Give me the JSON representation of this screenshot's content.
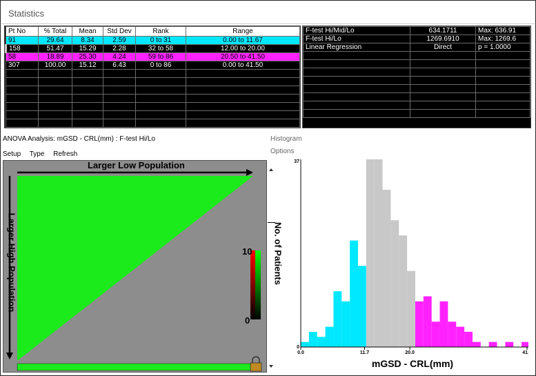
{
  "window": {
    "title": "Statistics"
  },
  "stats_table": {
    "headers": [
      "Pt No",
      "% Total",
      "Mean",
      "Std Dev",
      "Rank",
      "Range"
    ],
    "rows": [
      {
        "pt": "91",
        "pct": "29.64",
        "mean": "8.34",
        "sd": "2.59",
        "rank": "0 to 31",
        "range": "0.00 to 11.67",
        "color": "#00e8ff"
      },
      {
        "pt": "158",
        "pct": "51.47",
        "mean": "15.29",
        "sd": "2.28",
        "rank": "32 to 58",
        "range": "12.00 to 20.00",
        "color": "#c8c8c8"
      },
      {
        "pt": "58",
        "pct": "18.89",
        "mean": "25.30",
        "sd": "4.24",
        "rank": "59 to 86",
        "range": "20.50 to 41.50",
        "color": "#ff22ff"
      },
      {
        "pt": "307",
        "pct": "100.00",
        "mean": "15.12",
        "sd": "6.43",
        "rank": "0 to 86",
        "range": "0.00 to 41.50",
        "color": "#000000"
      }
    ]
  },
  "ftest_table": {
    "rows": [
      {
        "label": "F-test Hi/Mid/Lo",
        "value": "634.1711",
        "extra": "Max: 636.91"
      },
      {
        "label": "F-test Hi/Lo",
        "value": "1269.6910",
        "extra": "Max: 1269.6"
      },
      {
        "label": "Linear Regression",
        "value": "Direct",
        "extra": "p =  1.0000"
      }
    ]
  },
  "anova": {
    "title": "ANOVA Analysis: mGSD - CRL(mm) : F-test Hi/Lo",
    "menu": [
      "Setup",
      "Type",
      "Refresh"
    ],
    "x_arrow_label": "Larger Low Population",
    "y_arrow_label": "Larger High Population",
    "colorbar_max": "10",
    "colorbar_min": "0"
  },
  "histogram": {
    "title": "Histogram",
    "options": "Options",
    "ylabel": "No. of Patients",
    "xlabel": "mGSD - CRL(mm)",
    "ytick_top": "37",
    "ytick_bottom": "0"
  },
  "chart_data": {
    "type": "bar",
    "title": "Histogram",
    "xlabel": "mGSD - CRL(mm)",
    "ylabel": "No. of Patients",
    "xlim": [
      0,
      41.5
    ],
    "ylim": [
      0,
      37
    ],
    "xticks": [
      "0.0",
      "11.7",
      "20.0",
      "41.5"
    ],
    "bin_width": 1.5,
    "bins": [
      0.0,
      1.5,
      3.0,
      4.5,
      6.0,
      7.5,
      9.0,
      10.5,
      12.0,
      13.5,
      15.0,
      16.5,
      18.0,
      19.5,
      21.0,
      22.5,
      24.0,
      25.5,
      27.0,
      28.5,
      30.0,
      31.5,
      33.0,
      34.5,
      36.0,
      37.5,
      39.0,
      40.5
    ],
    "values": [
      1,
      3,
      2,
      4,
      11,
      9,
      21,
      16,
      37,
      37,
      31,
      25,
      22,
      15,
      9,
      10,
      5,
      9,
      5,
      4,
      3,
      1,
      0,
      1,
      0,
      1,
      0,
      1
    ],
    "groups": [
      {
        "name": "Low",
        "range": "0.00 to 11.67",
        "color": "#00e8ff"
      },
      {
        "name": "Mid",
        "range": "12.00 to 20.00",
        "color": "#c8c8c8"
      },
      {
        "name": "High",
        "range": "20.50 to 41.50",
        "color": "#ff22ff"
      }
    ]
  }
}
